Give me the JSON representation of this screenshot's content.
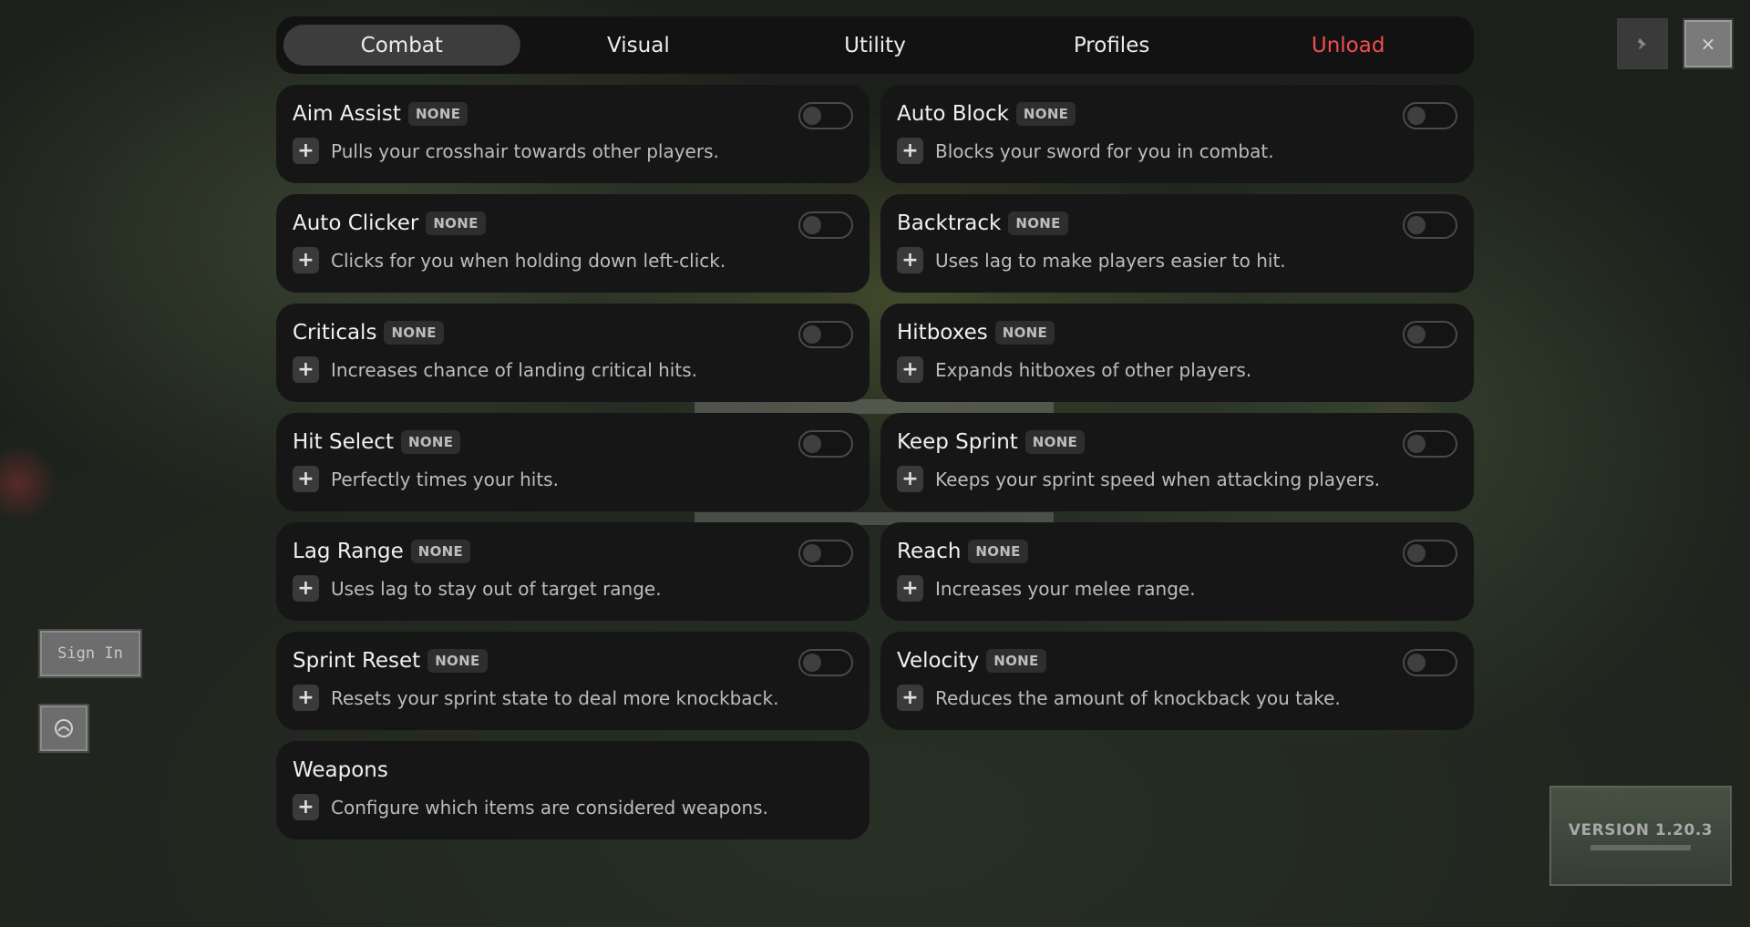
{
  "tabs": [
    {
      "label": "Combat",
      "active": true
    },
    {
      "label": "Visual",
      "active": false
    },
    {
      "label": "Utility",
      "active": false
    },
    {
      "label": "Profiles",
      "active": false
    },
    {
      "label": "Unload",
      "active": false,
      "color": "#f04d52"
    }
  ],
  "modules": [
    {
      "name": "Aim Assist",
      "bind": "NONE",
      "desc": "Pulls your crosshair towards other players."
    },
    {
      "name": "Auto Block",
      "bind": "NONE",
      "desc": "Blocks your sword for you in combat."
    },
    {
      "name": "Auto Clicker",
      "bind": "NONE",
      "desc": "Clicks for you when holding down left-click."
    },
    {
      "name": "Backtrack",
      "bind": "NONE",
      "desc": "Uses lag to make players easier to hit."
    },
    {
      "name": "Criticals",
      "bind": "NONE",
      "desc": "Increases chance of landing critical hits."
    },
    {
      "name": "Hitboxes",
      "bind": "NONE",
      "desc": "Expands hitboxes of other players."
    },
    {
      "name": "Hit Select",
      "bind": "NONE",
      "desc": "Perfectly times your hits."
    },
    {
      "name": "Keep Sprint",
      "bind": "NONE",
      "desc": "Keeps your sprint speed when attacking players."
    },
    {
      "name": "Lag Range",
      "bind": "NONE",
      "desc": "Uses lag to stay out of target range."
    },
    {
      "name": "Reach",
      "bind": "NONE",
      "desc": "Increases your melee range."
    },
    {
      "name": "Sprint Reset",
      "bind": "NONE",
      "desc": "Resets your sprint state to deal more knockback."
    },
    {
      "name": "Velocity",
      "bind": "NONE",
      "desc": "Reduces the amount of knockback you take."
    },
    {
      "name": "Weapons",
      "desc": "Configure which items are considered weapons."
    }
  ],
  "background": {
    "sign_in": "Sign In",
    "version": "VERSION 1.20.3"
  },
  "icons": {
    "plus": "+",
    "close": "×",
    "pin": "pin-icon"
  },
  "colors": {
    "accent_danger": "#f04d52",
    "panel": "#161616",
    "tabbar": "#121212",
    "active_tab": "#3d3d3d"
  }
}
